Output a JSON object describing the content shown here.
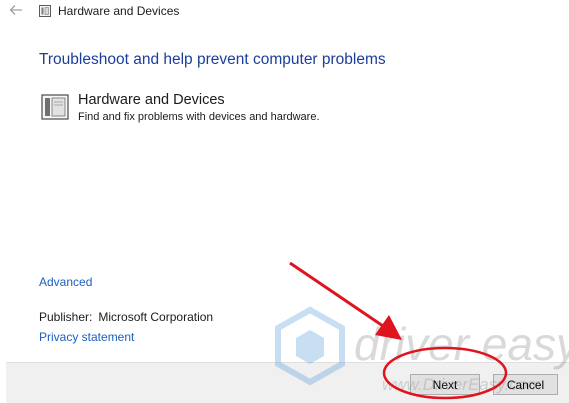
{
  "window": {
    "title": "Hardware and Devices",
    "back_icon": "back-arrow-icon",
    "app_icon": "troubleshooter-icon"
  },
  "main": {
    "heading": "Troubleshoot and help prevent computer problems",
    "item": {
      "icon": "hardware-device-icon",
      "title": "Hardware and Devices",
      "description": "Find and fix problems with devices and hardware."
    },
    "advanced_link": "Advanced",
    "publisher_label": "Publisher:",
    "publisher_value": "Microsoft Corporation",
    "privacy_link": "Privacy statement"
  },
  "footer": {
    "next_label": "Next",
    "cancel_label": "Cancel"
  },
  "watermark": {
    "text": "driver easy",
    "url": "www.DriverEasy.com"
  },
  "colors": {
    "heading": "#1b3d9c",
    "link": "#1e5ebd",
    "annotation": "#e0141e",
    "footer_bg": "#f0f0f0"
  }
}
